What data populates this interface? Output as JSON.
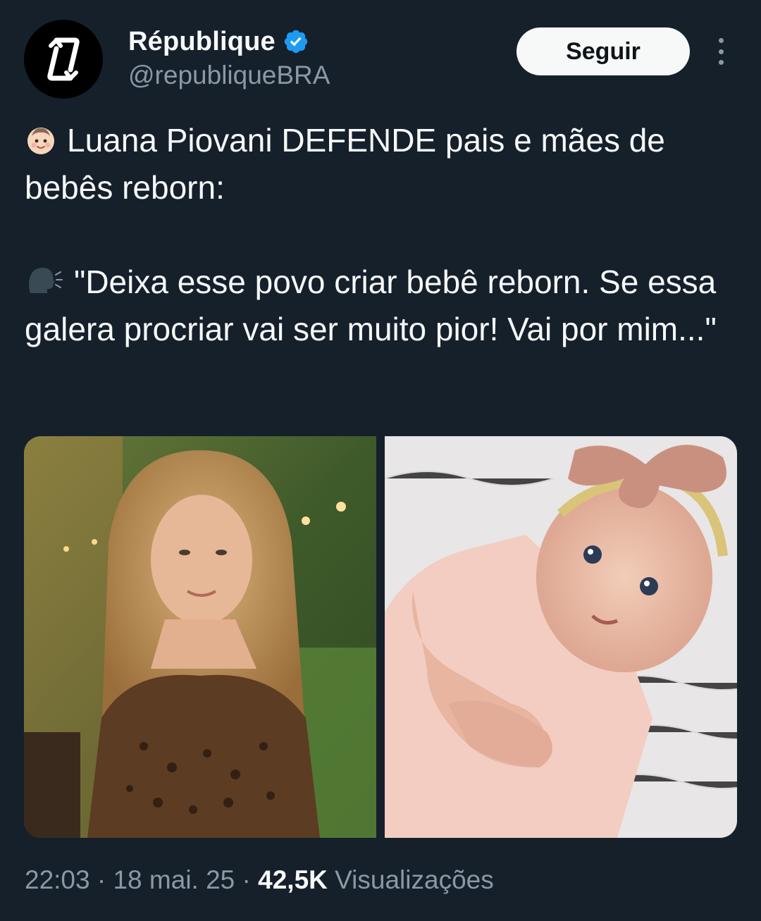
{
  "account": {
    "display_name": "République",
    "handle": "@republiqueBRA",
    "avatar_icon": "republique-logo-icon",
    "verified_icon": "verified-badge-icon",
    "verified_color": "#1d9bf0"
  },
  "actions": {
    "follow_label": "Seguir",
    "more_icon": "more-vertical-icon"
  },
  "tweet": {
    "paragraph1_emoji": "baby-emoji",
    "paragraph1_text": "Luana Piovani DEFENDE pais e mães de bebês reborn:",
    "paragraph2_emoji": "speaking-head-emoji",
    "paragraph2_text": "\"Deixa esse povo criar bebê reborn. Se essa galera procriar vai ser muito pior! Vai por mim...\""
  },
  "media": {
    "images": [
      {
        "description": "Woman with long wavy blonde hair in leopard print top, garden background"
      },
      {
        "description": "Reborn baby doll in pink outfit with pink bow headband on white blanket"
      }
    ]
  },
  "meta": {
    "time": "22:03",
    "separator": "·",
    "date": "18 mai. 25",
    "views_count": "42,5K",
    "views_label": "Visualizações"
  },
  "colors": {
    "background": "#15202b",
    "text_primary": "#f7f9f9",
    "text_secondary": "#8b98a5",
    "button_bg": "#f7f9f9",
    "button_text": "#0f1419"
  }
}
